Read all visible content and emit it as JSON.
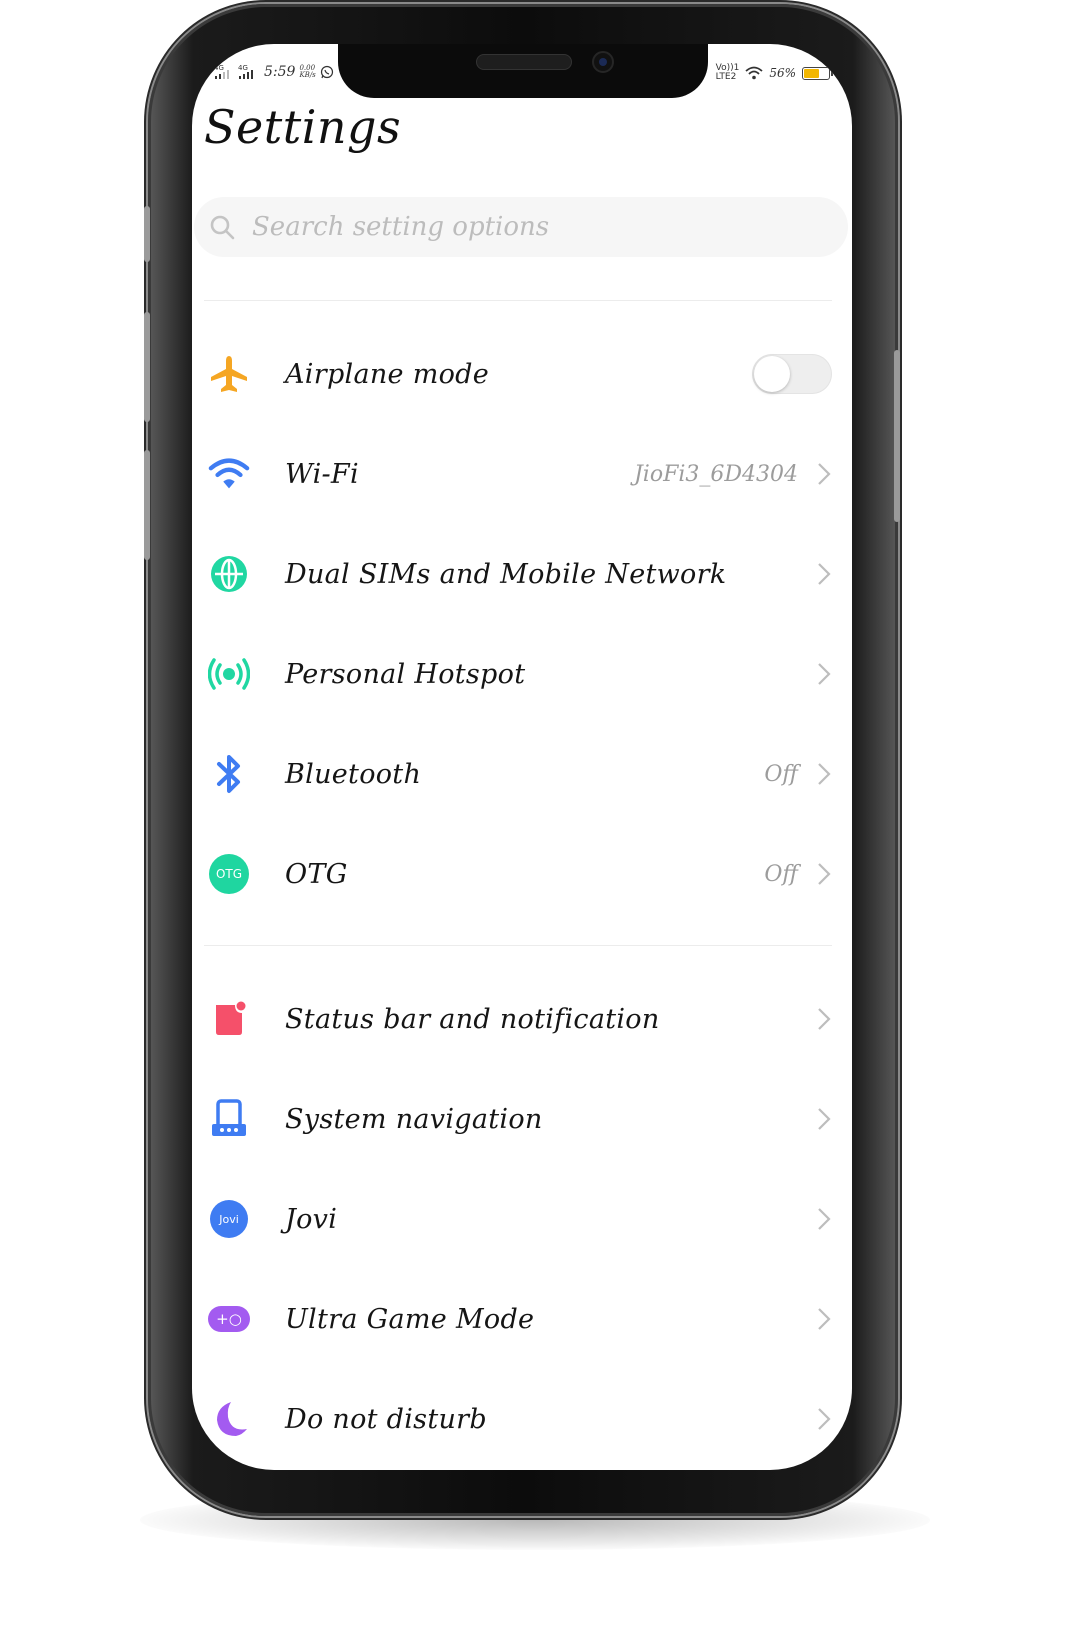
{
  "status_bar": {
    "sim1": "4G",
    "sim2": "4G",
    "time": "5:59",
    "speed": "0.00",
    "speed_unit": "KB/s",
    "volte": "Vo))1",
    "lte": "LTE2",
    "battery": "56%",
    "battery_level": 0.56
  },
  "page": {
    "title": "Settings"
  },
  "search": {
    "placeholder": "Search setting options"
  },
  "rows": [
    {
      "label": "Airplane mode",
      "icon": "airplane-icon",
      "toggle": false,
      "color": "#f5a623"
    },
    {
      "label": "Wi-Fi",
      "icon": "wifi-icon",
      "value": "JioFi3_6D4304",
      "color": "#3f7cf2"
    },
    {
      "label": "Dual SIMs and Mobile Network",
      "icon": "globe-icon",
      "color": "#20d7a2"
    },
    {
      "label": "Personal Hotspot",
      "icon": "hotspot-icon",
      "color": "#20d7a2"
    },
    {
      "label": "Bluetooth",
      "icon": "bluetooth-icon",
      "value": "Off",
      "color": "#3f7cf2"
    },
    {
      "label": "OTG",
      "icon": "otg-icon",
      "icon_text": "OTG",
      "value": "Off",
      "color": "#1fd6a0"
    },
    {
      "label": "Status bar and notification",
      "icon": "notification-icon",
      "color": "#f5506a"
    },
    {
      "label": "System navigation",
      "icon": "navigation-icon",
      "color": "#3f7cf2"
    },
    {
      "label": "Jovi",
      "icon": "jovi-icon",
      "icon_text": "Jovi",
      "color": "#3f7cf2"
    },
    {
      "label": "Ultra Game Mode",
      "icon": "game-icon",
      "icon_text": "+○",
      "color": "#a35bf0"
    },
    {
      "label": "Do not disturb",
      "icon": "moon-icon",
      "color": "#a35bf0"
    }
  ]
}
